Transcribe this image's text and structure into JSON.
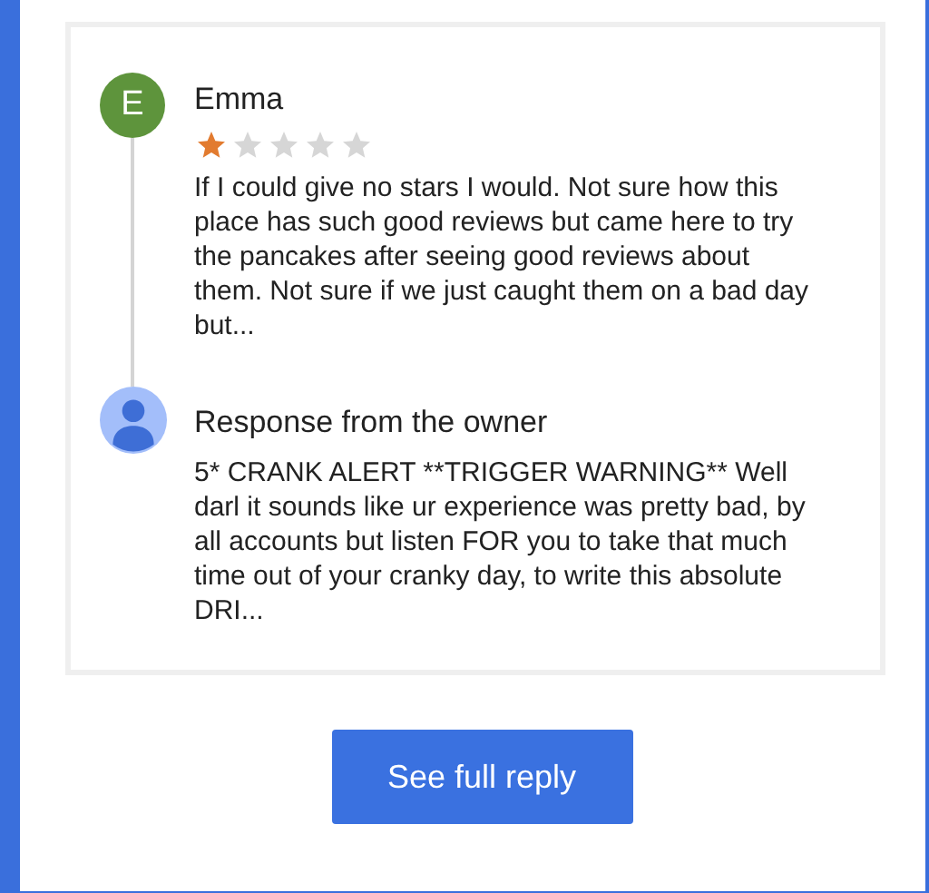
{
  "review": {
    "author": "Emma",
    "avatar_letter": "E",
    "stars": 1,
    "text": "If I could give no stars I would. Not sure how this place has such good reviews but came here to try the pancakes after seeing good reviews about them. Not sure if we just caught them on a bad day but..."
  },
  "response": {
    "title": "Response from the owner",
    "text": "5* CRANK ALERT **TRIGGER WARNING** Well darl it sounds like ur experience was pretty bad, by all accounts but listen FOR you to take that much time out of your cranky day, to write this absolute DRI..."
  },
  "button": "See full reply"
}
